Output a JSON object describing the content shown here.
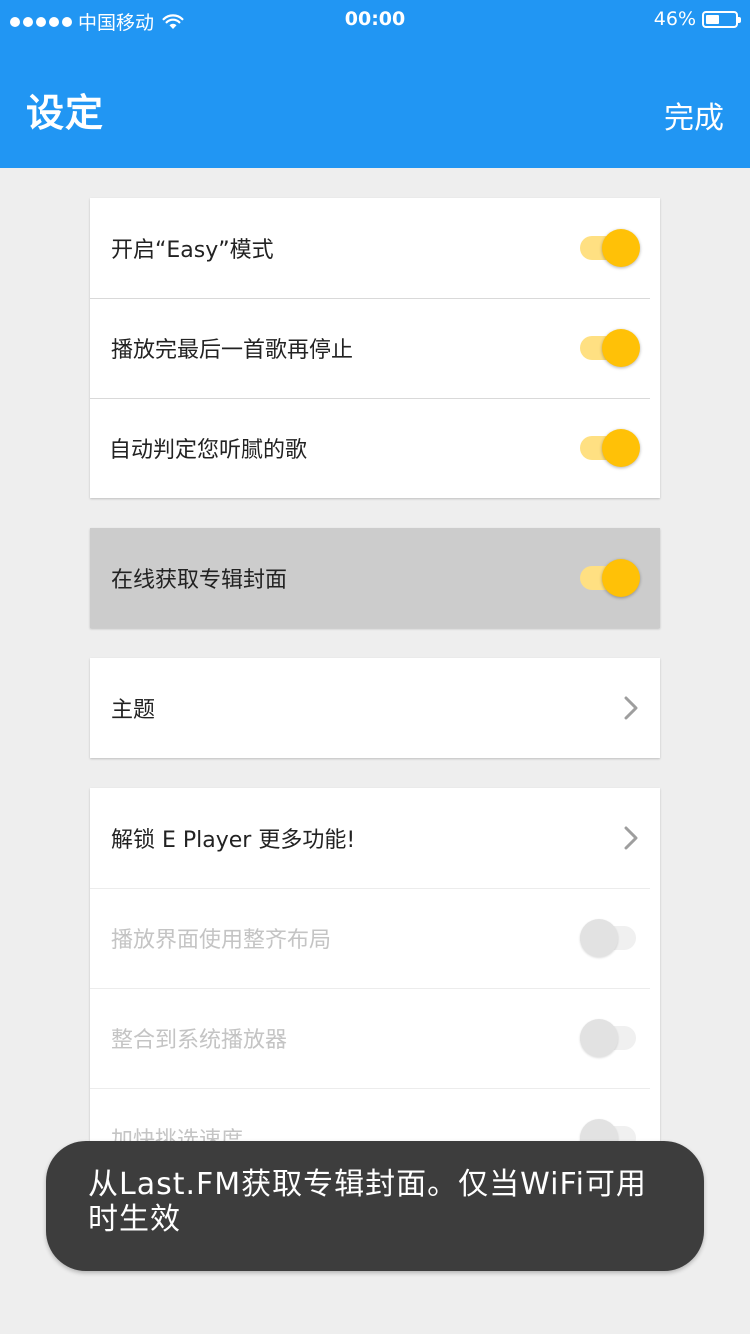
{
  "status_bar": {
    "carrier": "中国移动",
    "time": "00:00",
    "battery_percent": "46%",
    "battery_level": 0.46
  },
  "header": {
    "title": "设定",
    "done_label": "完成"
  },
  "colors": {
    "header_bg": "#2196f3",
    "toggle_on_knob": "#ffc107",
    "toggle_on_track": "#ffe082",
    "highlight_row_bg": "#cccccc",
    "toast_bg": "#3d3d3d"
  },
  "groups": [
    {
      "items": [
        {
          "label": "开启“Easy”模式",
          "control": "toggle",
          "on": true
        },
        {
          "label": "播放完最后一首歌再停止",
          "control": "toggle",
          "on": true
        },
        {
          "label": "自动判定您听腻的歌",
          "control": "toggle",
          "on": true
        }
      ]
    },
    {
      "items": [
        {
          "label": "在线获取专辑封面",
          "control": "toggle",
          "on": true,
          "highlighted": true
        }
      ]
    },
    {
      "items": [
        {
          "label": "主题",
          "control": "chevron-right-icon"
        }
      ]
    },
    {
      "items": [
        {
          "label": "解锁 E Player 更多功能!",
          "control": "chevron-right-icon"
        },
        {
          "label": "播放界面使用整齐布局",
          "control": "toggle",
          "on": false,
          "disabled": true
        },
        {
          "label": "整合到系统播放器",
          "control": "toggle",
          "on": false,
          "disabled": true
        },
        {
          "label": "加快挑选速度",
          "control": "toggle",
          "on": false,
          "disabled": true
        }
      ]
    }
  ],
  "toast": {
    "message": "从Last.FM获取专辑封面。仅当WiFi可用时生效"
  }
}
